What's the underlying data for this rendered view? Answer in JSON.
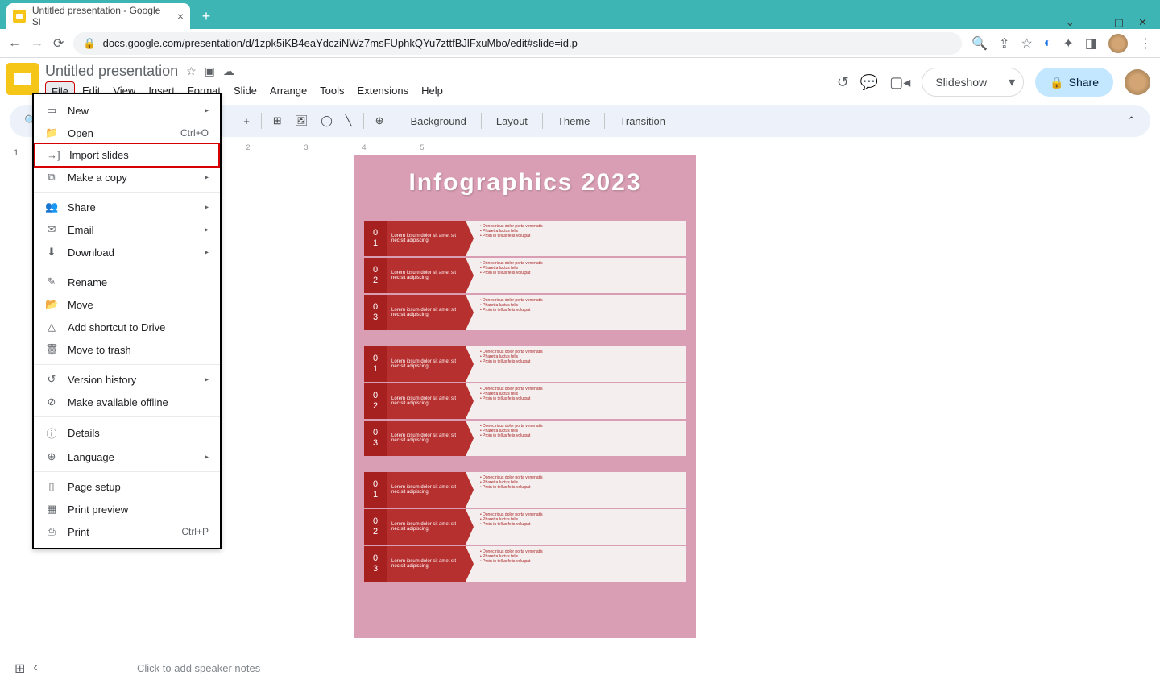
{
  "browser": {
    "tab_title": "Untitled presentation - Google Sl",
    "url": "docs.google.com/presentation/d/1zpk5iKB4eaYdcziNWz7msFUphkQYu7zttfBJlFxuMbo/edit#slide=id.p"
  },
  "doc": {
    "title": "Untitled presentation"
  },
  "menubar": [
    "File",
    "Edit",
    "View",
    "Insert",
    "Format",
    "Slide",
    "Arrange",
    "Tools",
    "Extensions",
    "Help"
  ],
  "header_buttons": {
    "slideshow": "Slideshow",
    "share": "Share"
  },
  "toolbar_text": {
    "background": "Background",
    "layout": "Layout",
    "theme": "Theme",
    "transition": "Transition"
  },
  "dropdown": {
    "new": "New",
    "open": "Open",
    "open_sc": "Ctrl+O",
    "import": "Import slides",
    "copy": "Make a copy",
    "share": "Share",
    "email": "Email",
    "download": "Download",
    "rename": "Rename",
    "move": "Move",
    "shortcut": "Add shortcut to Drive",
    "trash": "Move to trash",
    "version": "Version history",
    "offline": "Make available offline",
    "details": "Details",
    "language": "Language",
    "pagesetup": "Page setup",
    "preview": "Print preview",
    "print": "Print",
    "print_sc": "Ctrl+P"
  },
  "slide": {
    "title": "Infographics 2023",
    "row_label": "Lorem ipsum dolor sit amet sit nec sit adipiscing",
    "bullets": [
      "Donec risus dolor porta venenatis",
      "Pharetra luctus felis",
      "Proin in tellus felis volutpat"
    ],
    "numbers": [
      "01",
      "02",
      "03"
    ]
  },
  "notes": {
    "placeholder": "Click to add speaker notes"
  },
  "slide_number": "1"
}
